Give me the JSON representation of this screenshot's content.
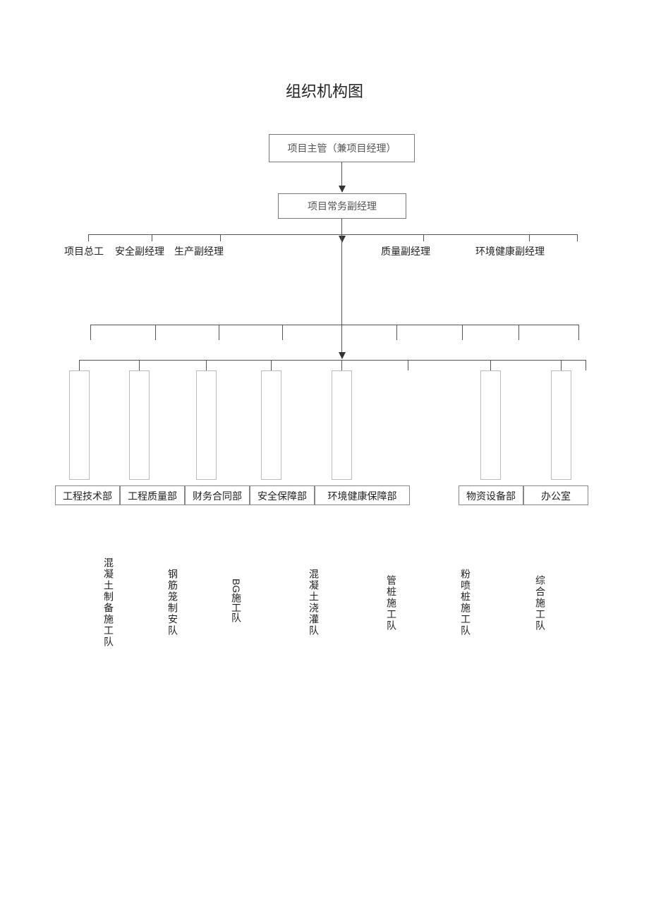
{
  "title": "组织机构图",
  "top_box": "项目主管（兼项目经理）",
  "second_box": "项目常务副经理",
  "row_deputies": {
    "d1": "项目总工",
    "d2": "安全副经理",
    "d3": "生产副经理",
    "d4": "质量副经理",
    "d5": "环境健康副经理"
  },
  "departments": {
    "p1": "工程技术部",
    "p2": "工程质量部",
    "p3": "财务合同部",
    "p4": "安全保障部",
    "p5": "环境健康保障部",
    "p6": "物资设备部",
    "p7": "办公室"
  },
  "teams": {
    "t1": "混凝土制备施工队",
    "t2": "钢筋笼制安队",
    "t3": "BG施工队",
    "t4": "混凝土浇灌队",
    "t5": "管桩施工队",
    "t6": "粉喷桩施工队",
    "t7": "综合施工队"
  }
}
